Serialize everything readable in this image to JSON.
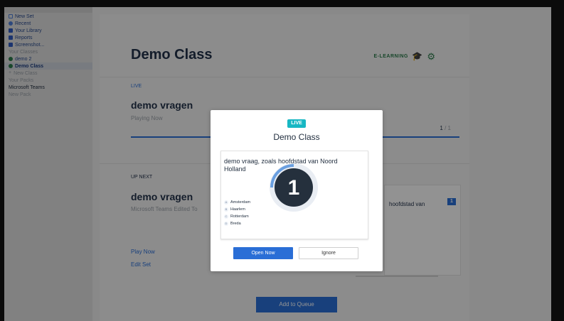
{
  "sidebar": {
    "items": [
      {
        "label": "New Set",
        "icon": "new-set-icon",
        "style": "link",
        "color": "#4f7fd8"
      },
      {
        "label": "Recent",
        "icon": "clock-icon",
        "style": "link",
        "color": "#4f7fd8"
      },
      {
        "label": "Your Library",
        "icon": "folder-icon",
        "style": "link",
        "color": "#2f5bbf"
      },
      {
        "label": "Reports",
        "icon": "report-icon",
        "style": "link",
        "color": "#2f5bbf"
      },
      {
        "label": "Screenshot...",
        "icon": "grid-icon",
        "style": "link",
        "color": "#2f5bbf"
      }
    ],
    "classes_heading": "Your Classes",
    "classes": [
      {
        "label": "demo 2",
        "icon": "class-dot-icon",
        "active": false,
        "color": "#2b7a4b"
      },
      {
        "label": "Demo Class",
        "icon": "class-dot-icon",
        "active": true,
        "color": "#2b7a4b"
      },
      {
        "label": "New Class",
        "icon": "plus-icon",
        "active": false,
        "color": "#9aa0a8"
      }
    ],
    "packs_heading": "Your Packs",
    "packs": [
      {
        "label": "Microsoft Teams",
        "style": "dark"
      },
      {
        "label": "New Pack",
        "style": "muted"
      }
    ]
  },
  "header": {
    "class_name": "Demo Class",
    "elearning_label": "E-LEARNING"
  },
  "live_section": {
    "label": "LIVE",
    "set_title": "demo vragen",
    "status": "Playing Now",
    "current": "1",
    "total": "1"
  },
  "upnext_section": {
    "label": "UP NEXT",
    "set_title": "demo vragen",
    "meta": "Microsoft Teams  Edited To",
    "preview_text": "hoofdstad van",
    "preview_badge": "1",
    "play_now": "Play Now",
    "edit_set": "Edit Set",
    "add_queue": "Add to Queue"
  },
  "modal": {
    "badge": "LIVE",
    "title": "Demo Class",
    "question": "demo vraag, zoals hoofdstad van Noord Holland",
    "answers": [
      {
        "key": "A",
        "text": "Amsterdam"
      },
      {
        "key": "B",
        "text": "Haarlem"
      },
      {
        "key": "C",
        "text": "Rotterdam"
      },
      {
        "key": "D",
        "text": "Breda"
      }
    ],
    "timer_value": "1",
    "timer_progress": 0.25,
    "open_label": "Open Now",
    "ignore_label": "Ignore"
  },
  "colors": {
    "accent": "#2a6ed6",
    "live": "#17b7c3",
    "elearning": "#2b7a4b"
  }
}
